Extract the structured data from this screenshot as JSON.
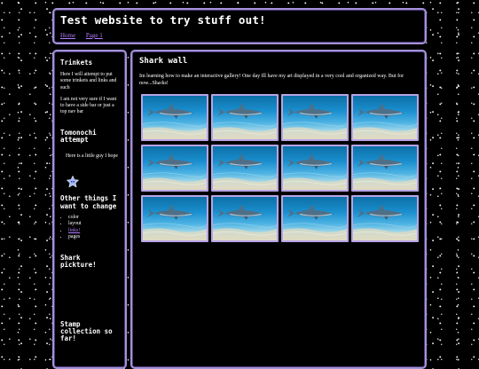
{
  "header": {
    "title": "Test website to try stuff out!",
    "nav": [
      {
        "label": "Home"
      },
      {
        "label": "Page 1"
      }
    ]
  },
  "sidebar": {
    "trinkets": {
      "heading": "Trinkets",
      "p1": "Here I will attempt to put some trinkets and links and such",
      "p2": "I am not very sure if I want to have a side bar or just a top nav bar"
    },
    "tomonochi": {
      "heading": "Tomonochi attempt",
      "text": "Here is a little guy I hope"
    },
    "other": {
      "heading": "Other things I want to change",
      "items": [
        "color",
        "layout",
        "links!",
        "pages"
      ]
    },
    "shark_pick": {
      "heading": "Shark pickture!"
    },
    "stamps": {
      "heading": "Stamp collection so far!"
    }
  },
  "main": {
    "title": "Shark wall",
    "description": "Im learning how to make an interactive gallery! One day Ill have my art displayed in a very cool and organized way. But for now...Sharks!",
    "gallery_count": 12
  },
  "colors": {
    "border": "#a591d8",
    "link": "#b07cff",
    "background": "#000000"
  }
}
